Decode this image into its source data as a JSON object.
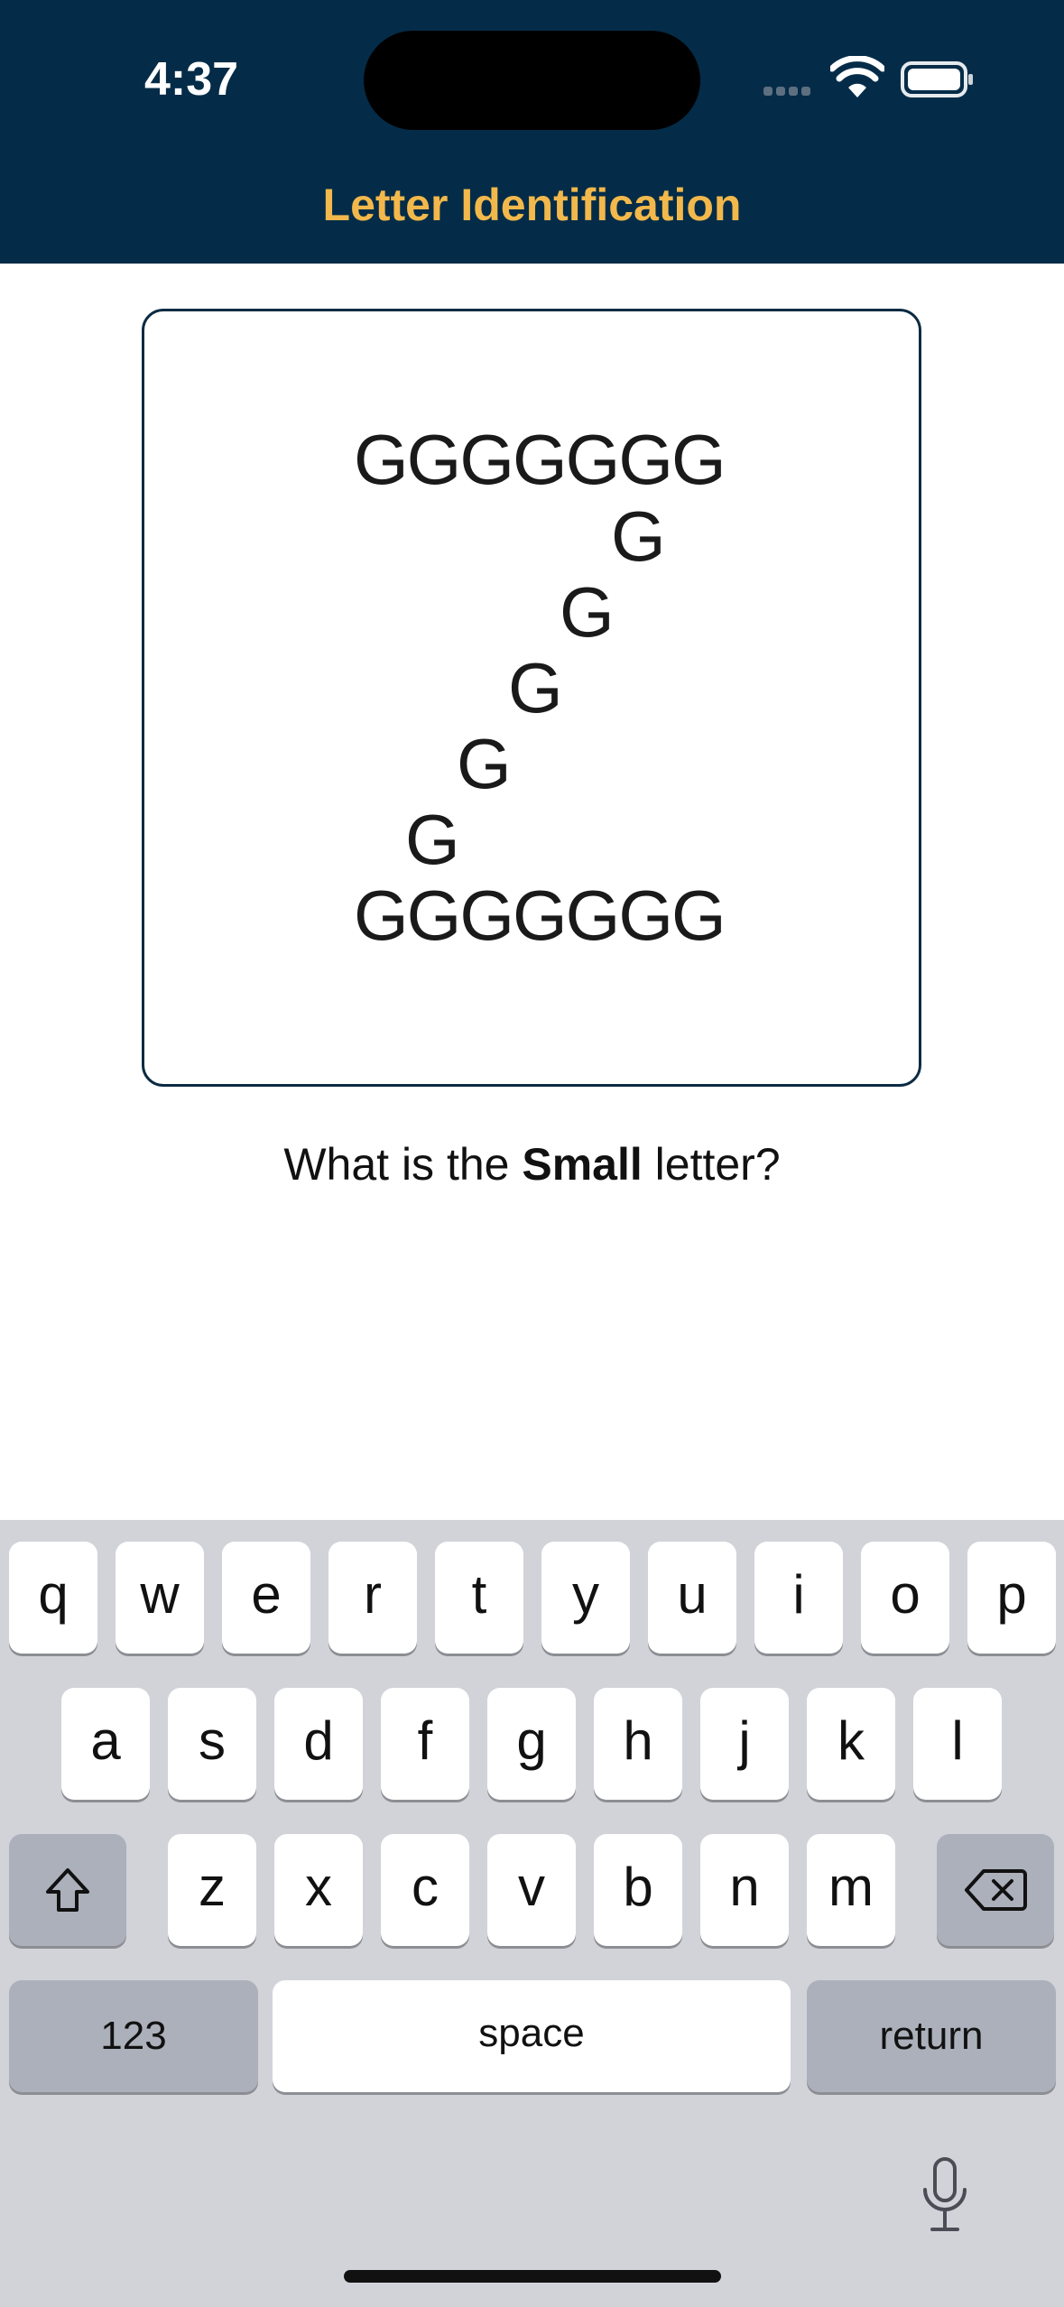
{
  "status_bar": {
    "time": "4:37"
  },
  "header": {
    "title": "Letter Identification"
  },
  "stimulus": {
    "rows": [
      "GGGGGGG",
      "G",
      "G",
      "G",
      "G",
      "G",
      "GGGGGGG"
    ]
  },
  "question": {
    "prefix": "What is the ",
    "emphasis": "Small",
    "suffix": " letter?"
  },
  "keyboard": {
    "row1": [
      "q",
      "w",
      "e",
      "r",
      "t",
      "y",
      "u",
      "i",
      "o",
      "p"
    ],
    "row2": [
      "a",
      "s",
      "d",
      "f",
      "g",
      "h",
      "j",
      "k",
      "l"
    ],
    "row3": [
      "z",
      "x",
      "c",
      "v",
      "b",
      "n",
      "m"
    ],
    "numbers_label": "123",
    "space_label": "space",
    "return_label": "return"
  },
  "colors": {
    "header_bg": "#042c48",
    "title": "#f2b84b",
    "card_border": "#0c2b43",
    "keyboard_bg": "#d1d3d9"
  },
  "icons": [
    "wifi-icon",
    "battery-icon",
    "shift-icon",
    "delete-icon",
    "microphone-icon"
  ]
}
